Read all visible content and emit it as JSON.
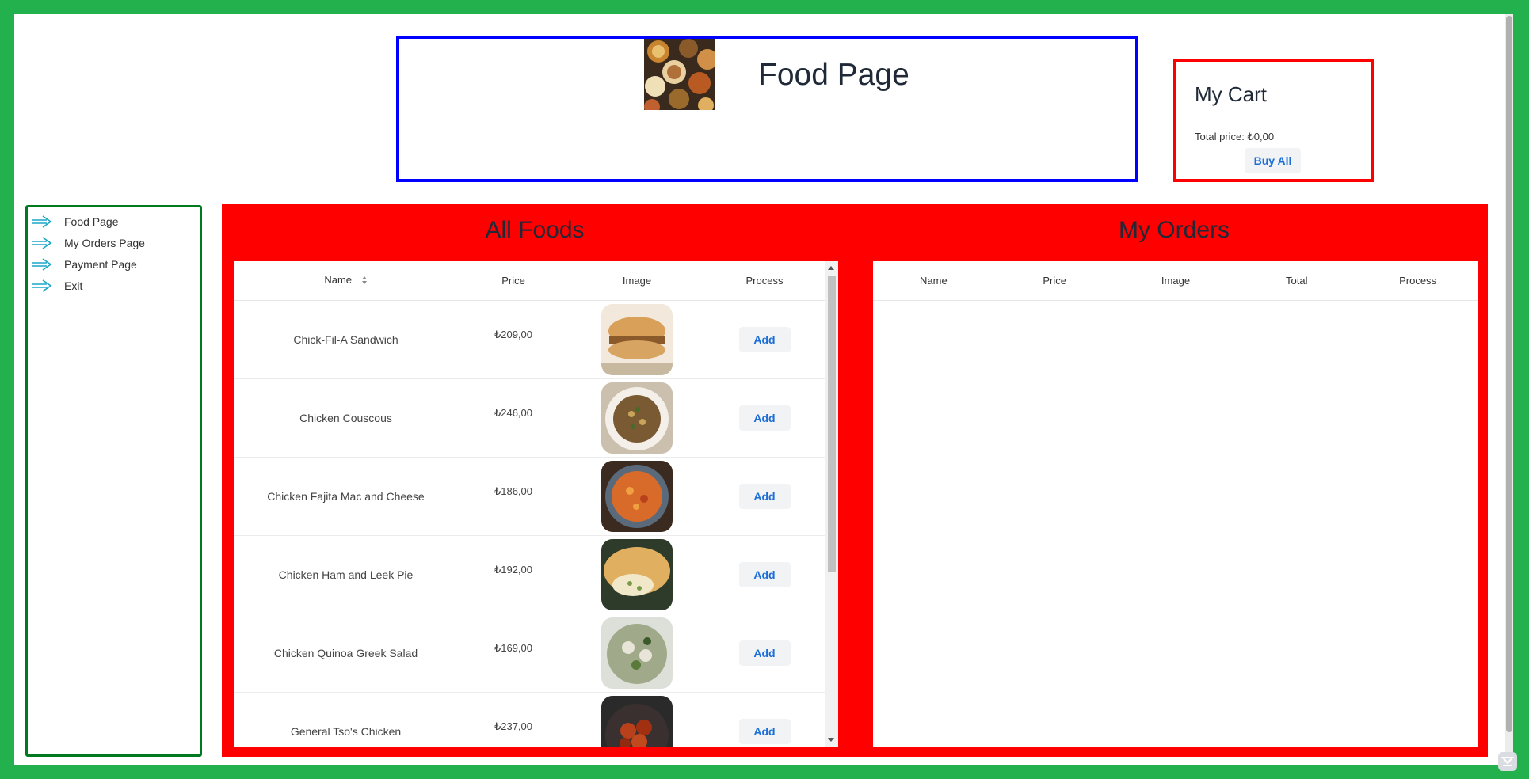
{
  "header": {
    "title": "Food Page",
    "image_icon": "food-spread-photo"
  },
  "cart": {
    "title": "My Cart",
    "total_label": "Total price: ₺0,00",
    "buy_label": "Buy All"
  },
  "sidebar": {
    "items": [
      {
        "label": "Food Page",
        "icon": "arrow-right-icon"
      },
      {
        "label": "My Orders Page",
        "icon": "arrow-right-icon"
      },
      {
        "label": "Payment Page",
        "icon": "arrow-right-icon"
      },
      {
        "label": "Exit",
        "icon": "arrow-right-icon"
      }
    ]
  },
  "all_foods": {
    "title": "All Foods",
    "columns": [
      "Name",
      "Price",
      "Image",
      "Process"
    ],
    "sort_icon": "sort-icon",
    "rows": [
      {
        "name": "Chick-Fil-A Sandwich",
        "price": "₺209,00",
        "action": "Add"
      },
      {
        "name": "Chicken Couscous",
        "price": "₺246,00",
        "action": "Add"
      },
      {
        "name": "Chicken Fajita Mac and Cheese",
        "price": "₺186,00",
        "action": "Add"
      },
      {
        "name": "Chicken Ham and Leek Pie",
        "price": "₺192,00",
        "action": "Add"
      },
      {
        "name": "Chicken Quinoa Greek Salad",
        "price": "₺169,00",
        "action": "Add"
      },
      {
        "name": "General Tso's Chicken",
        "price": "₺237,00",
        "action": "Add"
      }
    ]
  },
  "my_orders": {
    "title": "My Orders",
    "columns": [
      "Name",
      "Price",
      "Image",
      "Total",
      "Process"
    ],
    "rows": []
  },
  "colors": {
    "frame": "#22b14c",
    "header_border": "#0000ff",
    "cart_border": "#ff0000",
    "sidebar_border": "#007a1f",
    "main_panel": "#ff0000",
    "button_text": "#1d6fd8",
    "arrow_icon": "#1aa6c8"
  }
}
